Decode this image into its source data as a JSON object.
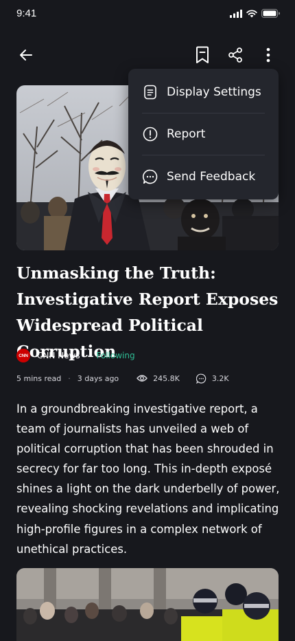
{
  "status_bar": {
    "time": "9:41"
  },
  "topbar": {
    "back_icon": "arrow-left-icon",
    "bookmark_icon": "bookmark-icon",
    "share_icon": "share-icon",
    "more_icon": "more-vertical-icon"
  },
  "menu": {
    "items": [
      {
        "label": "Display Settings",
        "icon": "document-icon"
      },
      {
        "label": "Report",
        "icon": "alert-circle-icon"
      },
      {
        "label": "Send Feedback",
        "icon": "chat-bubble-icon"
      }
    ]
  },
  "article": {
    "title_lines": [
      "Unmasking the Truth:",
      "Investigative Report Exposes",
      "Widespread Political Corruption"
    ],
    "source": {
      "logo_text": "CNN",
      "name": "CNN News",
      "follow_label": "Following"
    },
    "meta": {
      "read_time": "5 mins read",
      "posted": "3 days ago",
      "views": "245.8K",
      "comments": "3.2K"
    },
    "body_lines": [
      "In a groundbreaking investigative report, a",
      "team of journalists has unveiled a web of",
      "political corruption that has been shrouded in",
      "secrecy for far too long. This in-depth exposé",
      "shines a light on the dark underbelly of power,",
      "revealing shocking revelations and implicating",
      "high-profile figures in a complex network of",
      "unethical practices."
    ]
  },
  "colors": {
    "background": "#17181d",
    "menu_background": "#24262d",
    "accent_following": "#2fbf96",
    "brand_cnn": "#cc0000"
  }
}
